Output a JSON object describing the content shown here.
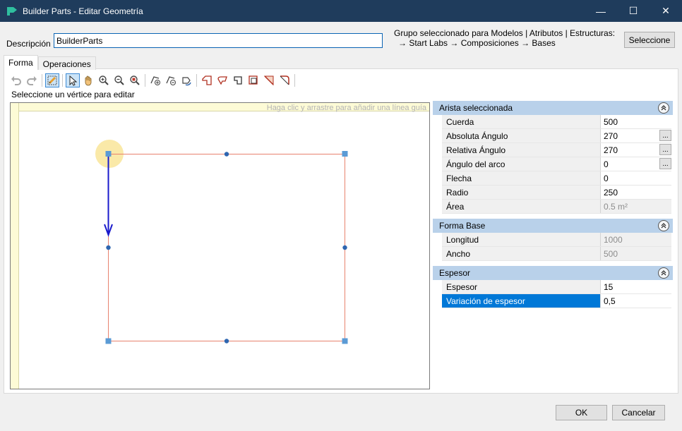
{
  "window": {
    "title": "Builder Parts - Editar Geometría",
    "minimize": "—",
    "maximize": "☐",
    "close": "✕"
  },
  "description": {
    "label": "Descripción",
    "value": "BuilderParts"
  },
  "group_info": {
    "line1": "Grupo seleccionado para Modelos | Atributos | Estructuras:",
    "line2": "→ Start Labs → Composiciones → Bases"
  },
  "select_button": "Seleccione",
  "tabs": [
    {
      "label": "Forma",
      "active": true
    },
    {
      "label": "Operaciones",
      "active": false
    }
  ],
  "toolbar": {
    "icons": [
      "undo-icon",
      "redo-icon",
      "edit-vertex-icon",
      "select-pointer-icon",
      "pan-hand-icon",
      "zoom-in-icon",
      "zoom-out-icon",
      "zoom-fit-icon",
      "add-vertex-icon",
      "remove-vertex-icon",
      "rotate-icon",
      "corner-bevel-icon",
      "corner-round-icon",
      "corner-notch-icon",
      "offset-icon",
      "mirror-h-icon",
      "mirror-v-icon"
    ]
  },
  "hint": "Seleccione un vértice para editar",
  "canvas": {
    "ruler_hint": "Haga clic y arrastre para añadir una línea guía",
    "colors": {
      "outline": "#e8826e",
      "handle": "#5b9bd5",
      "midpoint": "#2e66b0",
      "arrow": "#1a1acc",
      "highlight": "#fae9a8"
    }
  },
  "properties": {
    "sections": [
      {
        "title": "Arista seleccionada",
        "rows": [
          {
            "name": "Cuerda",
            "value": "500",
            "readonly": false,
            "button": false
          },
          {
            "name": "Absoluta Ángulo",
            "value": "270",
            "readonly": false,
            "button": true
          },
          {
            "name": "Relativa Ángulo",
            "value": "270",
            "readonly": false,
            "button": true
          },
          {
            "name": "Ángulo del arco",
            "value": "0",
            "readonly": false,
            "button": true
          },
          {
            "name": "Flecha",
            "value": "0",
            "readonly": false,
            "button": false
          },
          {
            "name": "Radio",
            "value": "250",
            "readonly": false,
            "button": false
          },
          {
            "name": "Área",
            "value": "0.5 m²",
            "readonly": true,
            "button": false
          }
        ]
      },
      {
        "title": "Forma Base",
        "rows": [
          {
            "name": "Longitud",
            "value": "1000",
            "readonly": true,
            "button": false
          },
          {
            "name": "Ancho",
            "value": "500",
            "readonly": true,
            "button": false
          }
        ]
      },
      {
        "title": "Espesor",
        "rows": [
          {
            "name": "Espesor",
            "value": "15",
            "readonly": false,
            "button": false
          },
          {
            "name": "Variación de espesor",
            "value": "0,5",
            "readonly": false,
            "button": false,
            "selected": true
          }
        ]
      }
    ],
    "ellipsis": "...",
    "collapse_glyph": "⌃"
  },
  "buttons": {
    "ok": "OK",
    "cancel": "Cancelar"
  }
}
